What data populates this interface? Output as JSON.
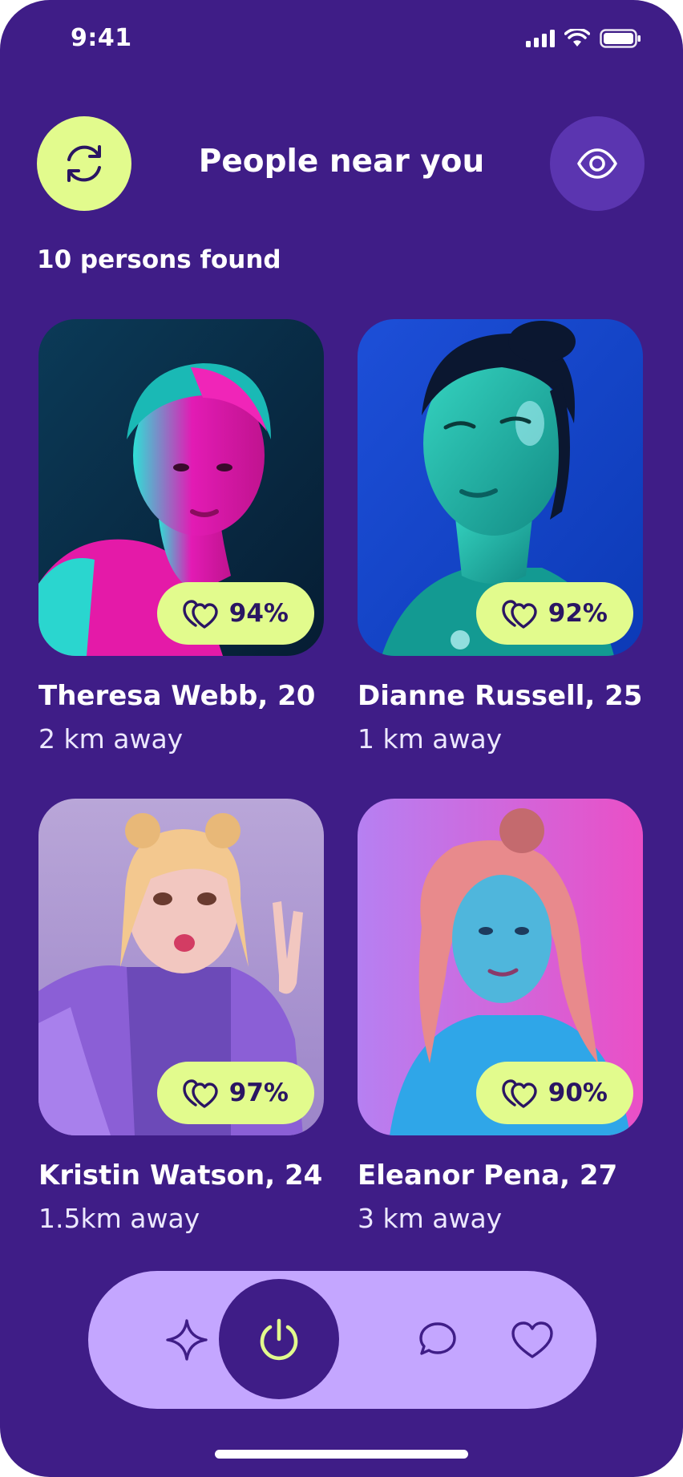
{
  "status_bar": {
    "time": "9:41"
  },
  "header": {
    "title": "People near you",
    "refresh_icon": "refresh-icon",
    "visibility_icon": "eye-icon"
  },
  "results": {
    "count_text": "10 persons found"
  },
  "people": [
    {
      "name": "Theresa Webb, 20",
      "distance": "2 km away",
      "match": "94%"
    },
    {
      "name": "Dianne Russell, 25",
      "distance": "1 km away",
      "match": "92%"
    },
    {
      "name": "Kristin Watson, 24",
      "distance": "1.5km away",
      "match": "97%"
    },
    {
      "name": "Eleanor Pena, 27",
      "distance": "3 km away",
      "match": "90%"
    }
  ],
  "tab_bar": {
    "items": [
      {
        "icon": "sparkle-icon",
        "active": false
      },
      {
        "icon": "power-icon",
        "active": true
      },
      {
        "icon": "chat-icon",
        "active": false
      },
      {
        "icon": "heart-icon",
        "active": false
      }
    ]
  },
  "colors": {
    "background": "#3f1d87",
    "accent_lime": "#e2fb8d",
    "eye_button": "#5b35b0",
    "tab_bar": "#c4a6ff",
    "tab_active": "#3f1d87",
    "dark_text": "#2a1563"
  }
}
